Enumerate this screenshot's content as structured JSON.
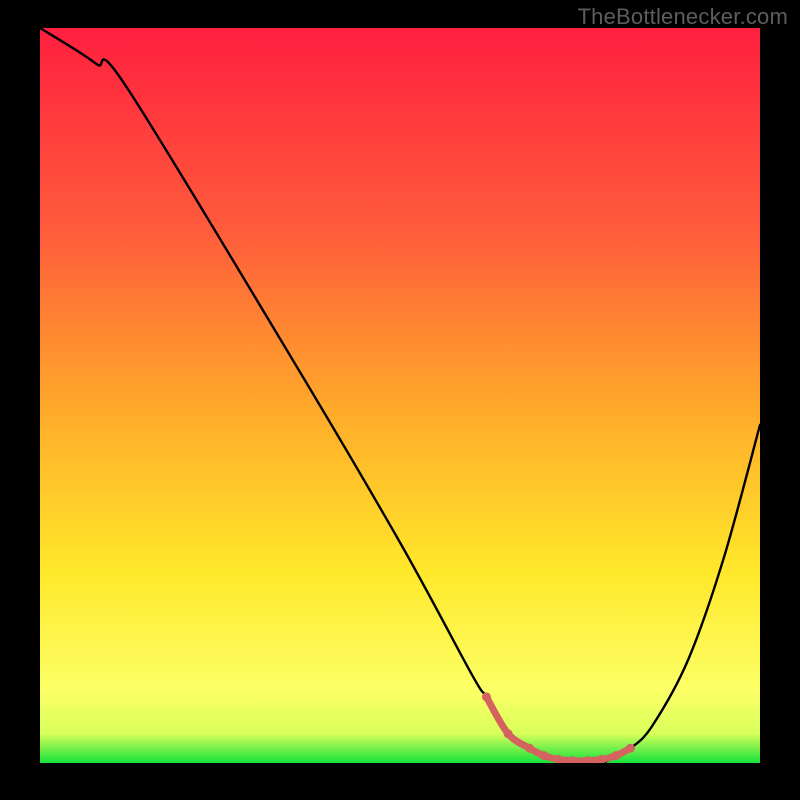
{
  "watermark": "TheBottlenecker.com",
  "colors": {
    "gradient_top": "#ff1f3f",
    "gradient_mid_upper": "#ff5d3b",
    "gradient_mid": "#ffaa2a",
    "gradient_mid_lower": "#ffe82a",
    "gradient_lower": "#fcff66",
    "gradient_bottom": "#14e23a",
    "curve": "#000000",
    "accent_dots": "#d4635f",
    "accent_segment": "#d4635f",
    "frame_bg": "#000000"
  },
  "chart_data": {
    "type": "line",
    "title": "",
    "xlabel": "",
    "ylabel": "",
    "xlim": [
      0,
      100
    ],
    "ylim": [
      0,
      100
    ],
    "series": [
      {
        "name": "bottleneck-curve",
        "x": [
          0,
          5,
          8,
          12,
          35,
          50,
          60,
          62,
          65,
          70,
          75,
          78,
          80,
          82,
          85,
          90,
          95,
          100
        ],
        "y": [
          100,
          97,
          95,
          92,
          55,
          30,
          12,
          9,
          4,
          1,
          0,
          0,
          1,
          2,
          5,
          14,
          28,
          46
        ]
      }
    ],
    "highlight_segment": {
      "x": [
        62,
        65,
        68,
        70,
        72,
        74,
        76,
        78,
        80,
        82
      ],
      "y": [
        9,
        4,
        2.0,
        1.0,
        0.5,
        0.3,
        0.3,
        0.5,
        1.0,
        2.0
      ]
    },
    "highlight_points": [
      {
        "x": 62,
        "y": 9
      },
      {
        "x": 65,
        "y": 4
      },
      {
        "x": 68,
        "y": 2.0
      },
      {
        "x": 70,
        "y": 1.0
      },
      {
        "x": 72,
        "y": 0.5
      },
      {
        "x": 74,
        "y": 0.3
      },
      {
        "x": 76,
        "y": 0.3
      },
      {
        "x": 78,
        "y": 0.5
      },
      {
        "x": 80,
        "y": 1.0
      },
      {
        "x": 82,
        "y": 2.0
      }
    ]
  }
}
